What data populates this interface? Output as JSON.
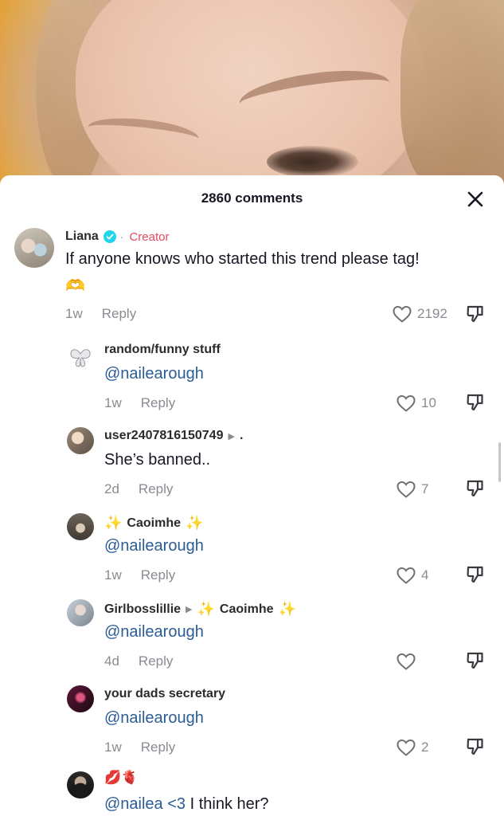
{
  "header": {
    "title": "2860 comments"
  },
  "comments": [
    {
      "author": "Liana",
      "creator_label": "Creator",
      "text": "If anyone knows who started this trend please tag!",
      "emoji": "🫶",
      "time": "1w",
      "reply": "Reply",
      "likes": "2192"
    },
    {
      "author": "random/funny stuff",
      "text": "@nailearough",
      "time": "1w",
      "reply": "Reply",
      "likes": "10"
    },
    {
      "author": "user2407816150749",
      "reply_to": ".",
      "text": "She’s banned..",
      "time": "2d",
      "reply": "Reply",
      "likes": "7"
    },
    {
      "author": "Caoimhe",
      "text": "@nailearough",
      "time": "1w",
      "reply": "Reply",
      "likes": "4"
    },
    {
      "author": "Girlbosslillie",
      "reply_to": "Caoimhe",
      "text": "@nailearough",
      "time": "4d",
      "reply": "Reply",
      "likes": ""
    },
    {
      "author": "your dads secretary",
      "text": "@nailearough",
      "time": "1w",
      "reply": "Reply",
      "likes": "2"
    },
    {
      "author": "💋🫀",
      "mention": "@nailea <3",
      "text": " I think her?"
    }
  ],
  "colors": {
    "creator": "#e04a5f",
    "mention": "#2b5c96",
    "verified": "#20d5ec",
    "meta": "#8a8b91"
  },
  "icons": {
    "close": "close-icon",
    "like": "heart-outline-icon",
    "dislike": "thumbs-down-icon",
    "verified": "verified-badge-icon"
  }
}
